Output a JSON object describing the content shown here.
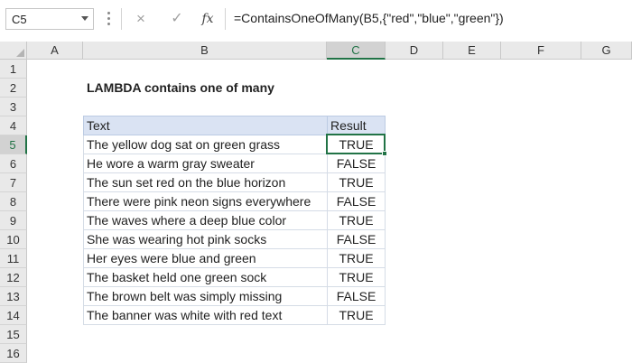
{
  "formula_bar": {
    "name_box": "C5",
    "cancel_icon": "×",
    "enter_icon": "✓",
    "fx_label": "fx",
    "formula": "=ContainsOneOfMany(B5,{\"red\",\"blue\",\"green\"})"
  },
  "columns": [
    "A",
    "B",
    "C",
    "D",
    "E",
    "F",
    "G"
  ],
  "rows": [
    "1",
    "2",
    "3",
    "4",
    "5",
    "6",
    "7",
    "8",
    "9",
    "10",
    "11",
    "12",
    "13",
    "14",
    "15",
    "16"
  ],
  "sheet": {
    "title": "LAMBDA contains one of many",
    "headers": {
      "text": "Text",
      "result": "Result"
    },
    "data": [
      {
        "text": "The yellow dog sat on green grass",
        "result": "TRUE"
      },
      {
        "text": "He wore a warm gray sweater",
        "result": "FALSE"
      },
      {
        "text": "The sun set red on the blue horizon",
        "result": "TRUE"
      },
      {
        "text": "There were pink neon signs everywhere",
        "result": "FALSE"
      },
      {
        "text": "The waves where a deep blue color",
        "result": "TRUE"
      },
      {
        "text": "She was wearing hot pink socks",
        "result": "FALSE"
      },
      {
        "text": "Her eyes were blue and green",
        "result": "TRUE"
      },
      {
        "text": "The basket held one green sock",
        "result": "TRUE"
      },
      {
        "text": "The brown belt was simply missing",
        "result": "FALSE"
      },
      {
        "text": "The banner was white with red text",
        "result": "TRUE"
      }
    ]
  },
  "colors": {
    "accent": "#217346",
    "table_header": "#dae3f3"
  }
}
